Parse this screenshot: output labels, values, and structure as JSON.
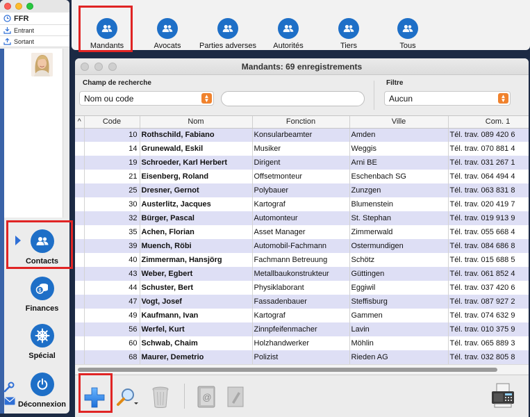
{
  "sidebar": {
    "app_name": "FFR",
    "inbox_label": "Entrant",
    "outbox_label": "Sortant",
    "nav": [
      {
        "label": "Contacts"
      },
      {
        "label": "Finances"
      },
      {
        "label": "Spécial"
      },
      {
        "label": "Déconnexion"
      }
    ]
  },
  "toolbar": {
    "buttons": [
      {
        "label": "Mandants"
      },
      {
        "label": "Avocats"
      },
      {
        "label": "Parties adverses"
      },
      {
        "label": "Autorités"
      },
      {
        "label": "Tiers"
      },
      {
        "label": "Tous"
      }
    ]
  },
  "window": {
    "title": "Mandants: 69 enregistrements",
    "search_label": "Champ de recherche",
    "search_field_value": "Nom ou code",
    "search_input_value": "",
    "filter_label": "Filtre",
    "filter_value": "Aucun"
  },
  "table": {
    "sort_indicator": "^",
    "columns": [
      "Code",
      "Nom",
      "Fonction",
      "Ville",
      "Com. 1"
    ],
    "rows": [
      [
        "10",
        "Rothschild, Fabiano",
        "Konsularbeamter",
        "Amden",
        "Tél. trav. 089 420 6"
      ],
      [
        "14",
        "Grunewald, Eskil",
        "Musiker",
        "Weggis",
        "Tél. trav. 070 881 4"
      ],
      [
        "19",
        "Schroeder, Karl Herbert",
        "Dirigent",
        "Arni BE",
        "Tél. trav. 031 267 1"
      ],
      [
        "21",
        "Eisenberg, Roland",
        "Offsetmonteur",
        "Eschenbach SG",
        "Tél. trav. 064 494 4"
      ],
      [
        "25",
        "Dresner, Gernot",
        "Polybauer",
        "Zunzgen",
        "Tél. trav. 063 831 8"
      ],
      [
        "30",
        "Austerlitz, Jacques",
        "Kartograf",
        "Blumenstein",
        "Tél. trav. 020 419 7"
      ],
      [
        "32",
        "Bürger, Pascal",
        "Automonteur",
        "St. Stephan",
        "Tél. trav. 019 913 9"
      ],
      [
        "35",
        "Achen, Florian",
        "Asset Manager",
        "Zimmerwald",
        "Tél. trav. 055 668 4"
      ],
      [
        "39",
        "Muench, Röbi",
        "Automobil-Fachmann",
        "Ostermundigen",
        "Tél. trav. 084 686 8"
      ],
      [
        "40",
        "Zimmerman, Hansjörg",
        "Fachmann Betreuung",
        "Schötz",
        "Tél. trav. 015 688 5"
      ],
      [
        "43",
        "Weber, Egbert",
        "Metallbaukonstrukteur",
        "Güttingen",
        "Tél. trav. 061 852 4"
      ],
      [
        "44",
        "Schuster, Bert",
        "Physiklaborant",
        "Eggiwil",
        "Tél. trav. 037 420 6"
      ],
      [
        "47",
        "Vogt, Josef",
        "Fassadenbauer",
        "Steffisburg",
        "Tél. trav. 087 927 2"
      ],
      [
        "49",
        "Kaufmann, Ivan",
        "Kartograf",
        "Gammen",
        "Tél. trav. 074 632 9"
      ],
      [
        "56",
        "Werfel, Kurt",
        "Zinnpfeifenmacher",
        "Lavin",
        "Tél. trav. 010 375 9"
      ],
      [
        "60",
        "Schwab, Chaim",
        "Holzhandwerker",
        "Möhlin",
        "Tél. trav. 065 889 3"
      ],
      [
        "68",
        "Maurer, Demetrio",
        "Polizist",
        "Rieden AG",
        "Tél. trav. 032 805 8"
      ],
      [
        "",
        "",
        "",
        "",
        ""
      ]
    ]
  },
  "colors": {
    "accent_blue": "#1e6fc7",
    "highlight_red": "#e02424",
    "row_alt": "#dedff5",
    "popup_orange": "#f0822d"
  },
  "icons": [
    "inbox-icon",
    "outbox-icon",
    "users-icon",
    "coins-icon",
    "helm-icon",
    "power-icon",
    "wrench-icon",
    "mail-icon",
    "add-icon",
    "search-icon",
    "trash-icon",
    "address-book-icon",
    "letter-icon",
    "fax-icon"
  ]
}
